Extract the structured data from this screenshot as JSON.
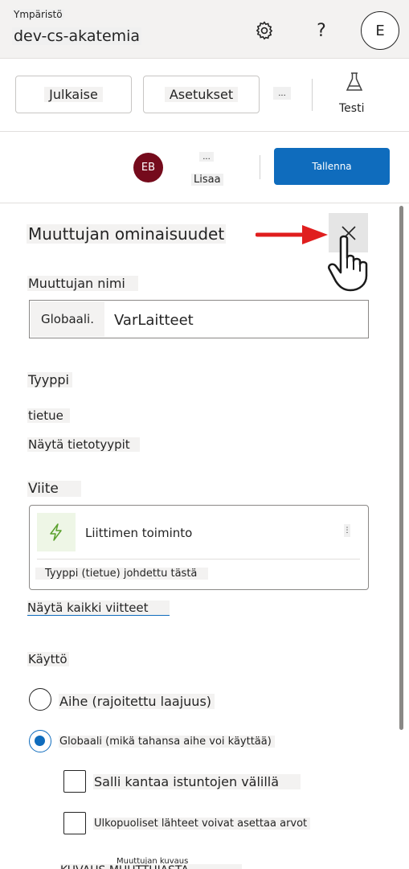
{
  "header": {
    "env_label": "Ympäristö",
    "env_name": "dev-cs-akatemia",
    "settings_icon": "gear-icon",
    "help_glyph": "?",
    "user_initial": "E"
  },
  "commands": {
    "publish": "Julkaise",
    "settings": "Asetukset",
    "more": "...",
    "test": "Testi",
    "test_icon": "flask-icon"
  },
  "toolbar": {
    "avatar_initials": "EB",
    "more": "...",
    "add": "Lisaa",
    "save": "Tallenna"
  },
  "panel": {
    "title": "Muuttujan ominaisuudet",
    "close_icon": "close-icon",
    "name_label": "Muuttujan nimi",
    "name_prefix": "Globaali.",
    "name_value": "VarLaitteet",
    "type_label": "Tyyppi",
    "type_value": "tietue",
    "show_types": "Näytä tietotyypit",
    "reference_label": "Viite",
    "reference_card": {
      "icon": "lightning-bolt-icon",
      "title": "Liittimen toiminto",
      "more": "⋮",
      "subtitle": "Tyyppi (tietue) johdettu tästä"
    },
    "show_all_refs": "Näytä kaikki viitteet",
    "usage_label": "Käyttö",
    "usage_options": [
      {
        "label": "Aihe (rajoitettu laajuus)",
        "selected": false
      },
      {
        "label": "Globaali (mikä tahansa aihe voi käyttää)",
        "selected": true
      }
    ],
    "checkboxes": [
      {
        "label": "Salli kantaa istuntojen välillä",
        "checked": false
      },
      {
        "label": "Ulkopuoliset lähteet voivat asettaa arvot",
        "checked": false
      }
    ],
    "description_label": "Muuttujan kuvaus",
    "description_cut": "KUVAUS MUUTTUJASTA"
  },
  "colors": {
    "accent": "#0f6cbd",
    "avatar": "#750b1c",
    "arrow": "#e01e1e",
    "bolt": "#5aa02c"
  }
}
